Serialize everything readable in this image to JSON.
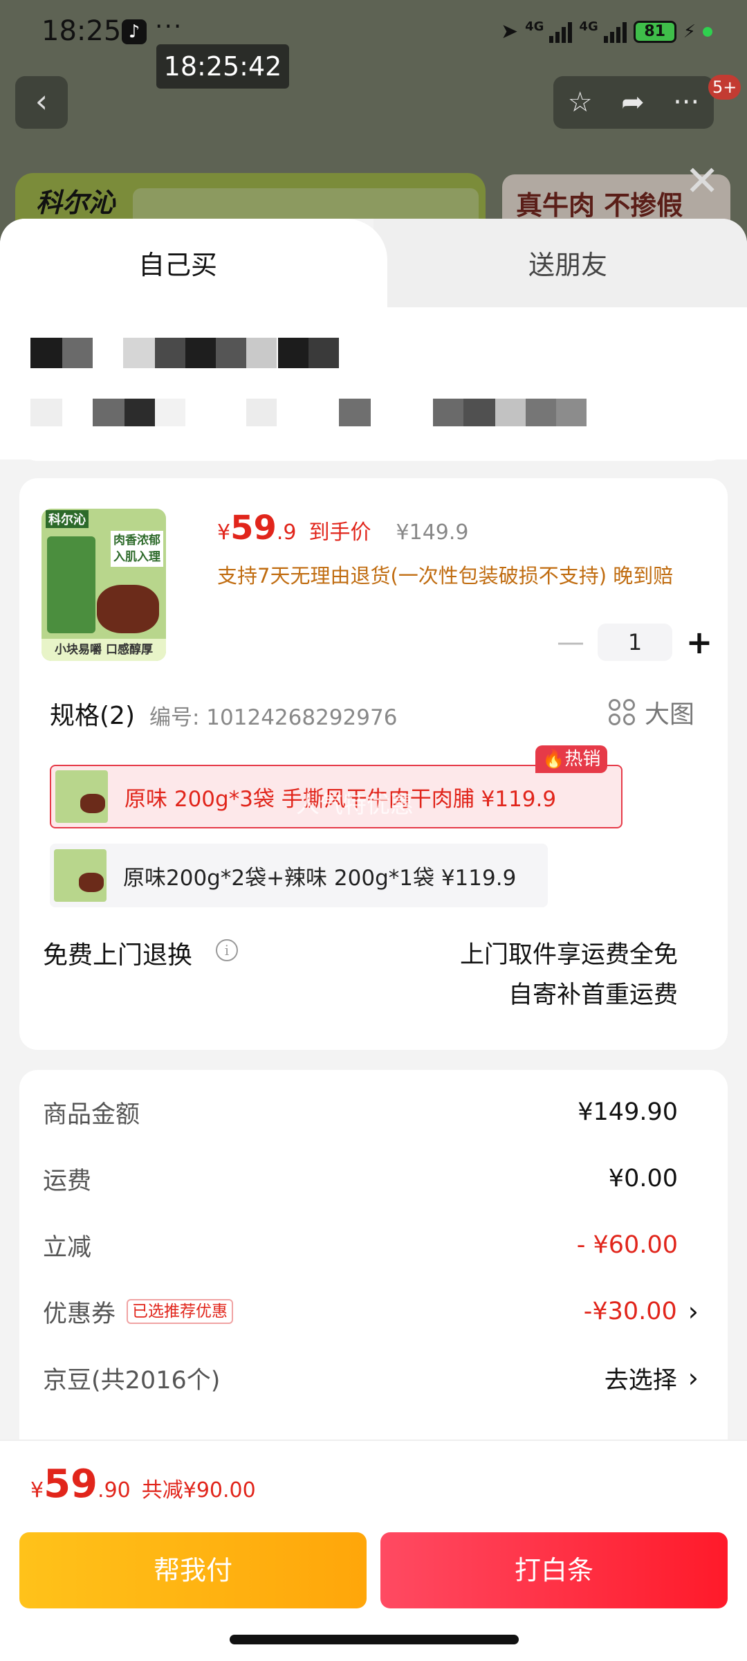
{
  "status_bar": {
    "time": "18:25",
    "dots": "···",
    "network_1": "4G",
    "network_2": "4G",
    "battery": "81"
  },
  "time_overlay": "18:25:42",
  "background": {
    "back_icon": "chevron-left-icon",
    "badge": "5+",
    "banner_logo": "科尔沁",
    "banner_right_text": "真牛肉 不掺假"
  },
  "tabs": {
    "self": "自己买",
    "friend": "送朋友"
  },
  "product": {
    "thumb_logo": "科尔沁",
    "thumb_copy_1": "肉香浓郁",
    "thumb_copy_2": "入肌入理",
    "thumb_strip": "小块易嚼 口感醇厚",
    "price_symbol": "¥",
    "price_int": "59",
    "price_dec": ".9",
    "price_label": "到手价",
    "original_price": "¥149.9",
    "return_note": "支持7天无理由退货(一次性包装破损不支持) 晚到赔",
    "quantity": "1",
    "minus": "—",
    "plus": "+"
  },
  "spec": {
    "title": "规格(2)",
    "code": "编号: 10124268292976",
    "big_pic_label": "大图",
    "hot_badge": "热销",
    "watermark": "人气特优惠",
    "options": [
      {
        "label": "原味 200g*3袋 手撕风干牛肉干肉脯  ¥119.9",
        "selected": true
      },
      {
        "label": "原味200g*2袋+辣味 200g*1袋  ¥119.9",
        "selected": false
      }
    ]
  },
  "free_return": {
    "label": "免费上门退换",
    "info_icon": "i",
    "right_line_1": "上门取件享运费全免",
    "right_line_2": "自寄补首重运费"
  },
  "summary": {
    "rows": [
      {
        "label": "商品金额",
        "value": "¥149.90"
      },
      {
        "label": "运费",
        "value": "¥0.00"
      },
      {
        "label": "立减",
        "value": "- ¥60.00"
      },
      {
        "label": "优惠券",
        "tag": "已选推荐优惠",
        "value": "-¥30.00"
      },
      {
        "label": "京豆(共2016个)",
        "value": "去选择"
      }
    ],
    "chevron": "›"
  },
  "footer": {
    "price_symbol": "¥",
    "price_int": "59",
    "price_dec": ".90",
    "total_saved": "共减¥90.00",
    "help_pay": "帮我付",
    "baitiao": "打白条"
  },
  "colors": {
    "accent_red": "#e1251b",
    "gold": "#ffb30f",
    "note_orange": "#c06c10"
  }
}
